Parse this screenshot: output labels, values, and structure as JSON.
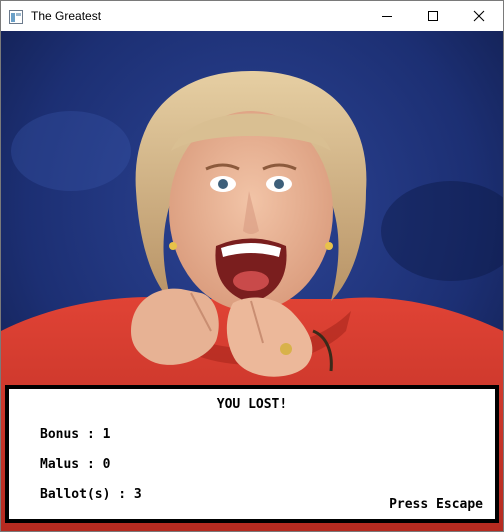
{
  "window": {
    "title": "The Greatest",
    "controls": [
      "minimize-icon",
      "maximize-icon",
      "close-icon"
    ]
  },
  "game": {
    "result": "YOU LOST!",
    "stats": {
      "bonus_label": "Bonus : ",
      "bonus_value": "1",
      "malus_label": "Malus : ",
      "malus_value": "0",
      "ballots_label": "Ballot(s) : ",
      "ballots_value": "3"
    },
    "hint": "Press Escape"
  },
  "colors": {
    "stage_blue": "#1c2f73",
    "jacket_red": "#d8382c",
    "hair_blonde": "#d6b98a",
    "panel_border": "#000000",
    "panel_bg": "#ffffff"
  }
}
